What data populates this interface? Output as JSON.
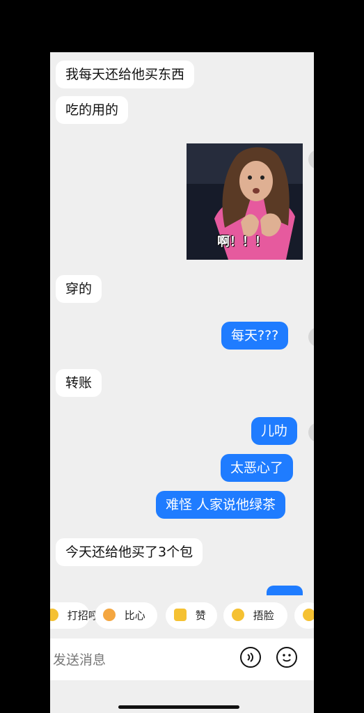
{
  "messages": [
    {
      "side": "left",
      "text": "我每天还给他买东西"
    },
    {
      "side": "left",
      "text": "吃的用的"
    },
    {
      "side": "right",
      "type": "sticker",
      "caption": "啊！！！"
    },
    {
      "side": "left",
      "text": "穿的"
    },
    {
      "side": "right",
      "text": "每天???"
    },
    {
      "side": "left",
      "text": "转账"
    },
    {
      "side": "right",
      "text": "儿叻"
    },
    {
      "side": "right",
      "text": "太恶心了"
    },
    {
      "side": "right",
      "text": "难怪 人家说他绿茶"
    },
    {
      "side": "left",
      "text": "今天还给他买了3个包"
    }
  ],
  "quick_reactions": [
    {
      "label": "打招呼",
      "icon": "wave-icon"
    },
    {
      "label": "比心",
      "icon": "heart-hands-icon"
    },
    {
      "label": "赞",
      "icon": "thumbs-up-icon"
    },
    {
      "label": "捂脸",
      "icon": "facepalm-icon"
    }
  ],
  "input": {
    "placeholder": "发送消息"
  },
  "colors": {
    "outgoing": "#1f7cff",
    "incoming": "#ffffff",
    "background": "#efefef"
  }
}
